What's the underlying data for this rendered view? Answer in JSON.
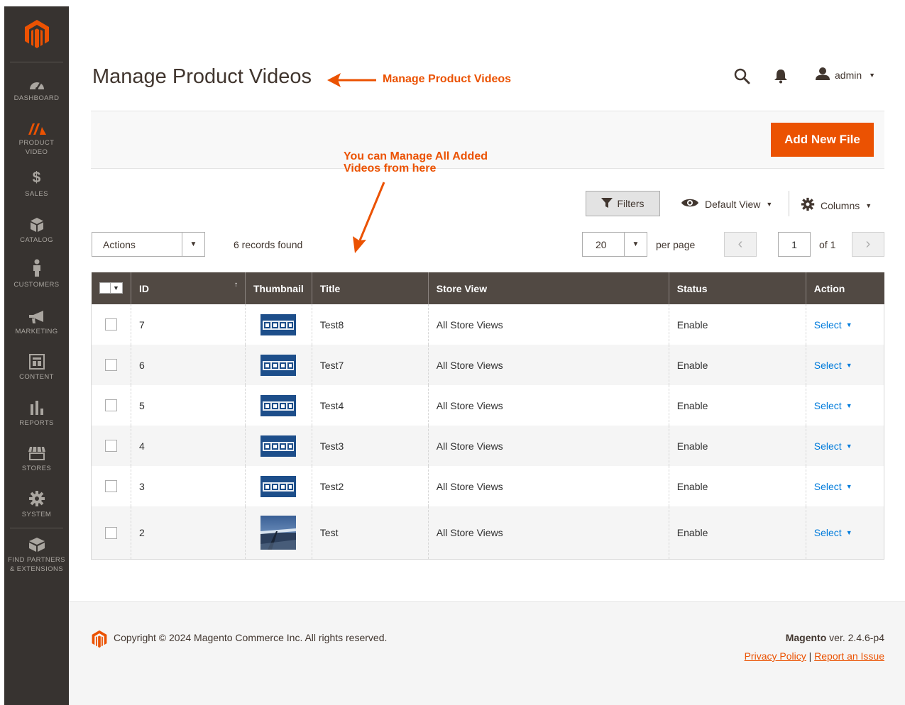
{
  "colors": {
    "accent": "#eb5202",
    "sidebar_bg": "#373330",
    "header_bg": "#514943",
    "link": "#007bdb"
  },
  "sidebar": {
    "logo": "magento-logo-icon",
    "items": [
      {
        "label": "DASHBOARD",
        "icon": "dashboard-icon"
      },
      {
        "label": "PRODUCT",
        "label2": "VIDEO",
        "icon": "product-video-icon"
      },
      {
        "label": "SALES",
        "icon": "dollar-icon"
      },
      {
        "label": "CATALOG",
        "icon": "cube-icon"
      },
      {
        "label": "CUSTOMERS",
        "icon": "person-icon"
      },
      {
        "label": "MARKETING",
        "icon": "megaphone-icon"
      },
      {
        "label": "CONTENT",
        "icon": "layout-icon"
      },
      {
        "label": "REPORTS",
        "icon": "bar-chart-icon"
      },
      {
        "label": "STORES",
        "icon": "storefront-icon"
      },
      {
        "label": "SYSTEM",
        "icon": "gear-icon"
      },
      {
        "label": "FIND PARTNERS",
        "label2": "& EXTENSIONS",
        "icon": "box-icon"
      }
    ]
  },
  "header": {
    "title": "Manage Product Videos",
    "title_annotation": "Manage Product Videos",
    "user": "admin"
  },
  "annotation_grid": {
    "line1": "You can Manage All Added",
    "line2": "Videos from here"
  },
  "toolbar": {
    "add_button": "Add New File",
    "filters": "Filters",
    "default_view": "Default View",
    "columns": "Columns",
    "actions": "Actions",
    "records": "6 records found",
    "per_page_value": "20",
    "per_page_label": "per page",
    "page_value": "1",
    "page_of": "of 1"
  },
  "grid": {
    "columns": [
      "ID",
      "Thumbnail",
      "Title",
      "Store View",
      "Status",
      "Action"
    ],
    "sort_indicator": "↑",
    "rows": [
      {
        "id": "7",
        "thumbnail": "demo-thumbnail",
        "title": "Test8",
        "store_view": "All Store Views",
        "status": "Enable",
        "action": "Select"
      },
      {
        "id": "6",
        "thumbnail": "demo-thumbnail",
        "title": "Test7",
        "store_view": "All Store Views",
        "status": "Enable",
        "action": "Select"
      },
      {
        "id": "5",
        "thumbnail": "demo-thumbnail",
        "title": "Test4",
        "store_view": "All Store Views",
        "status": "Enable",
        "action": "Select"
      },
      {
        "id": "4",
        "thumbnail": "demo-thumbnail",
        "title": "Test3",
        "store_view": "All Store Views",
        "status": "Enable",
        "action": "Select"
      },
      {
        "id": "3",
        "thumbnail": "demo-thumbnail",
        "title": "Test2",
        "store_view": "All Store Views",
        "status": "Enable",
        "action": "Select"
      },
      {
        "id": "2",
        "thumbnail": "photo-thumbnail",
        "title": "Test",
        "store_view": "All Store Views",
        "status": "Enable",
        "action": "Select"
      }
    ]
  },
  "footer": {
    "copyright": "Copyright © 2024 Magento Commerce Inc. All rights reserved.",
    "brand": "Magento",
    "version": "ver. 2.4.6-p4",
    "privacy": "Privacy Policy",
    "separator": "|",
    "report": "Report an Issue"
  }
}
